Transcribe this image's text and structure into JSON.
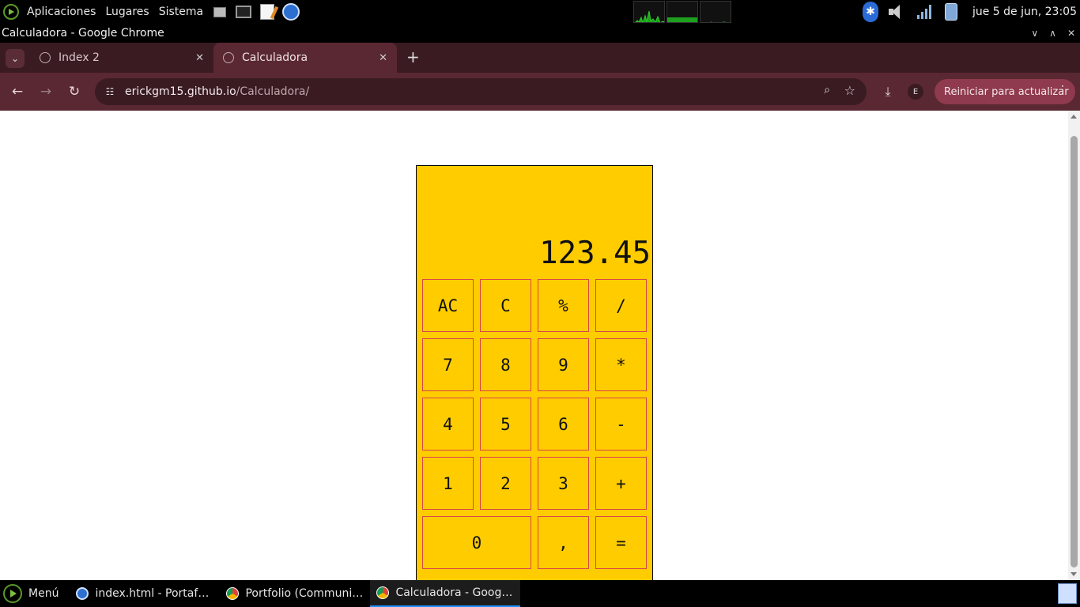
{
  "system_panel": {
    "menu_items": [
      "Aplicaciones",
      "Lugares",
      "Sistema"
    ],
    "clock": "jue  5 de jun, 23:05"
  },
  "window": {
    "title": "Calculadora - Google Chrome"
  },
  "tabs": [
    {
      "label": "Index 2",
      "active": false
    },
    {
      "label": "Calculadora",
      "active": true
    }
  ],
  "toolbar": {
    "url_host": "erickgm15.github.io",
    "url_path": "/Calculadora/",
    "profile_initial": "E",
    "update_button": "Reiniciar para actualizar"
  },
  "calculator": {
    "display": "123.45",
    "keys": [
      "AC",
      "C",
      "%",
      "/",
      "7",
      "8",
      "9",
      "*",
      "4",
      "5",
      "6",
      "-",
      "1",
      "2",
      "3",
      "+",
      "0",
      ",",
      "="
    ]
  },
  "taskbar": {
    "menu_label": "Menú",
    "tasks": [
      {
        "label": "index.html - Portafoli...",
        "icon": "web-icon"
      },
      {
        "label": "Portfolio (Community)...",
        "icon": "chrome-icon"
      },
      {
        "label": "Calculadora - Google ...",
        "icon": "chrome-icon",
        "active": true
      }
    ]
  },
  "colors": {
    "calculator_bg": "#ffcc00",
    "key_border": "#d9454a",
    "chrome_toolbar": "#5a2832"
  }
}
